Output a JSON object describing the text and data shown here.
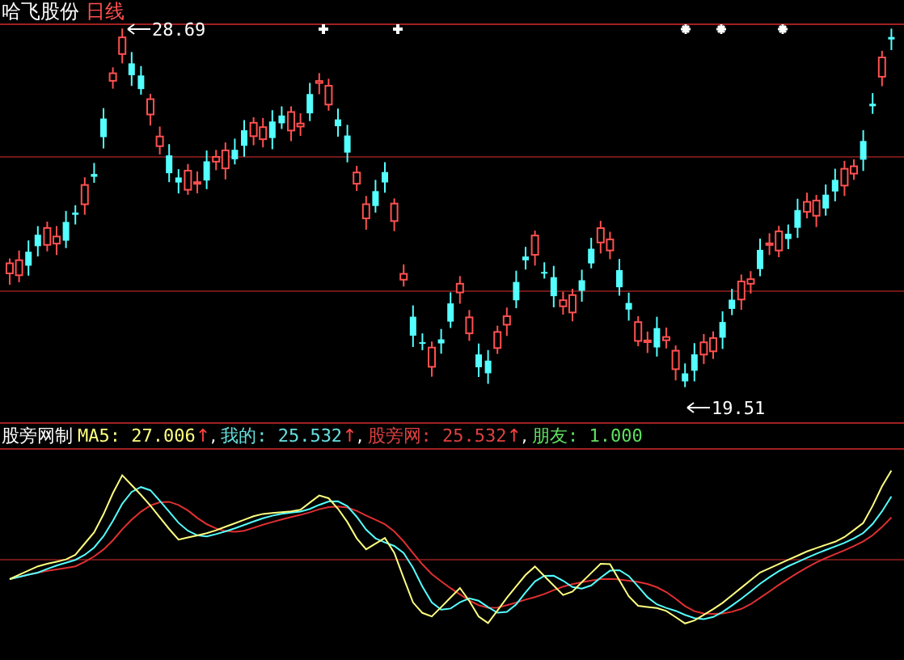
{
  "title": {
    "name": "哈飞股份",
    "period": "日线"
  },
  "price_labels": [
    {
      "kind": "high",
      "text": "28.69"
    },
    {
      "kind": "low",
      "text": "19.51"
    }
  ],
  "indicator": {
    "name": "股旁网制",
    "items": [
      {
        "kind": "average",
        "text": "MA5: 27.006",
        "arrow": "↑",
        "sep": ","
      },
      {
        "kind": "signal",
        "text": "我的: 25.532",
        "arrow": "↑",
        "sep": ","
      },
      {
        "kind": "line",
        "text": "股旁网: 25.532",
        "arrow": "↑",
        "sep": ","
      },
      {
        "kind": "constant",
        "text": "朋友: 1.000"
      }
    ]
  }
}
